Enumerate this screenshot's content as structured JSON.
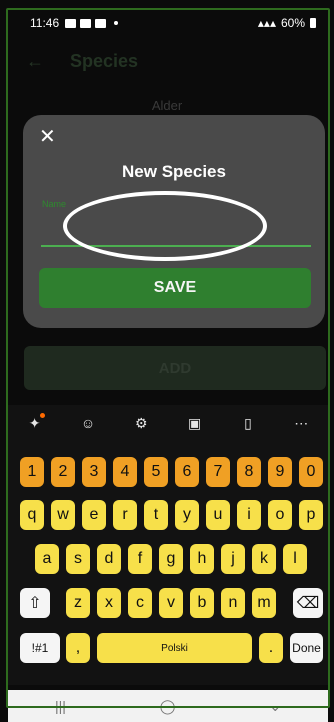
{
  "status": {
    "time": "11:46",
    "battery": "60%"
  },
  "appbar": {
    "back_icon": "arrow-left-icon",
    "title": "Species"
  },
  "background": {
    "item": "Alder",
    "add_label": "ADD"
  },
  "dialog": {
    "close_icon": "close-icon",
    "title": "New Species",
    "name_label": "Name",
    "name_value": "",
    "save_label": "SAVE"
  },
  "keyboard": {
    "toolbar": [
      "sparkle-icon",
      "emoji-icon",
      "settings-icon",
      "clipboard-icon",
      "one-handed-icon",
      "more-icon"
    ],
    "row_numbers": [
      "1",
      "2",
      "3",
      "4",
      "5",
      "6",
      "7",
      "8",
      "9",
      "0"
    ],
    "row1": [
      "q",
      "w",
      "e",
      "r",
      "t",
      "y",
      "u",
      "i",
      "o",
      "p"
    ],
    "row2": [
      "a",
      "s",
      "d",
      "f",
      "g",
      "h",
      "j",
      "k",
      "l"
    ],
    "row3": [
      "z",
      "x",
      "c",
      "v",
      "b",
      "n",
      "m"
    ],
    "shift_icon": "shift-icon",
    "backspace_icon": "backspace-icon",
    "symbols_label": "!#1",
    "comma_label": ",",
    "space_label": "Polski",
    "period_label": ".",
    "done_label": "Done"
  },
  "navbar": {
    "recent_icon": "recent-apps-icon",
    "home_icon": "home-icon",
    "back_icon": "chevron-down-icon"
  }
}
